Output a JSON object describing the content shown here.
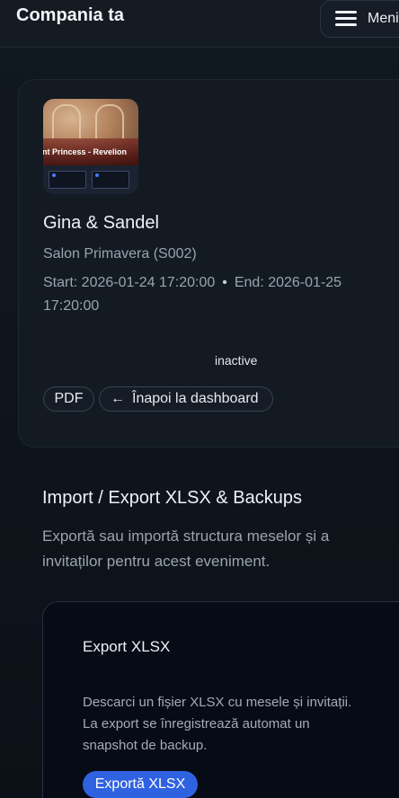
{
  "header": {
    "brand": "Compania ta",
    "menu_label": "Meniu"
  },
  "event": {
    "thumbnail_caption": "ant Princess - Revelion",
    "title": "Gina & Sandel",
    "venue": "Salon Primavera (S002)",
    "start": "Start: 2026-01-24 17:20:00",
    "separator": "•",
    "end": "End: 2026-01-25 17:20:00",
    "status": "inactive",
    "actions": {
      "pdf_label": "PDF",
      "back_arrow": "←",
      "back_label": "Înapoi la dashboard"
    }
  },
  "import_export": {
    "title": "Import / Export XLSX & Backups",
    "description": "Exportă sau importă structura meselor și a invitaților pentru acest eveniment.",
    "export_card": {
      "title": "Export XLSX",
      "description": "Descarci un fișier XLSX cu mesele și invitații. La export se înregistrează automat un snapshot de backup.",
      "button_label": "Exportă XLSX"
    }
  },
  "colors": {
    "accent": "#2f62e0",
    "background": "#0f141b",
    "card": "#131a22"
  }
}
